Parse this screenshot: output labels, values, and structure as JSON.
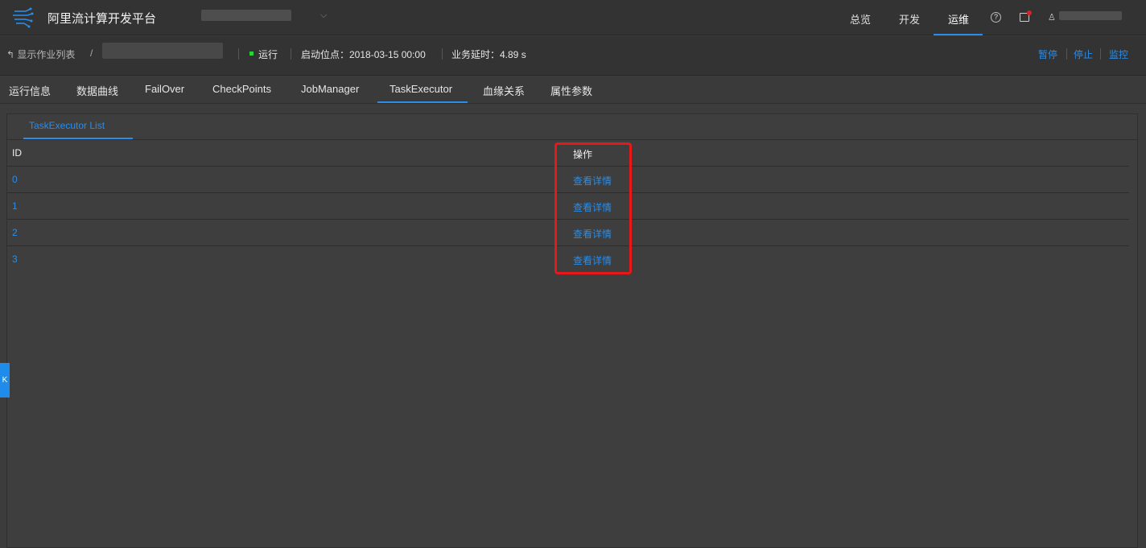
{
  "header": {
    "app_title": "阿里流计算开发平台",
    "nav": [
      "总览",
      "开发",
      "运维"
    ],
    "active_nav": "运维",
    "help_icon": "question-circle-icon",
    "notification_icon": "shirt-icon",
    "user_icon": "user-icon"
  },
  "job": {
    "back_label": "↰ 显示作业列表",
    "separator": "/",
    "status": "运行",
    "status_color": "#2bd33b",
    "start_position": "启动位点：2018-03-15 00:00",
    "business_delay": "业务延时：4.89 s",
    "actions": {
      "pause": "暂停",
      "stop": "停止",
      "monitor": "监控"
    }
  },
  "tabs": [
    "运行信息",
    "数据曲线",
    "FailOver",
    "CheckPoints",
    "JobManager",
    "TaskExecutor",
    "血缘关系",
    "属性参数"
  ],
  "active_tab": "TaskExecutor",
  "subtab": "TaskExecutor List",
  "table": {
    "headers": {
      "id": "ID",
      "op": "操作"
    },
    "rows": [
      {
        "id": "0",
        "op": "查看详情"
      },
      {
        "id": "1",
        "op": "查看详情"
      },
      {
        "id": "2",
        "op": "查看详情"
      },
      {
        "id": "3",
        "op": "查看详情"
      }
    ]
  },
  "side_toggle": "K",
  "accent_color": "#2b8de8",
  "highlight_color": "#e81818"
}
